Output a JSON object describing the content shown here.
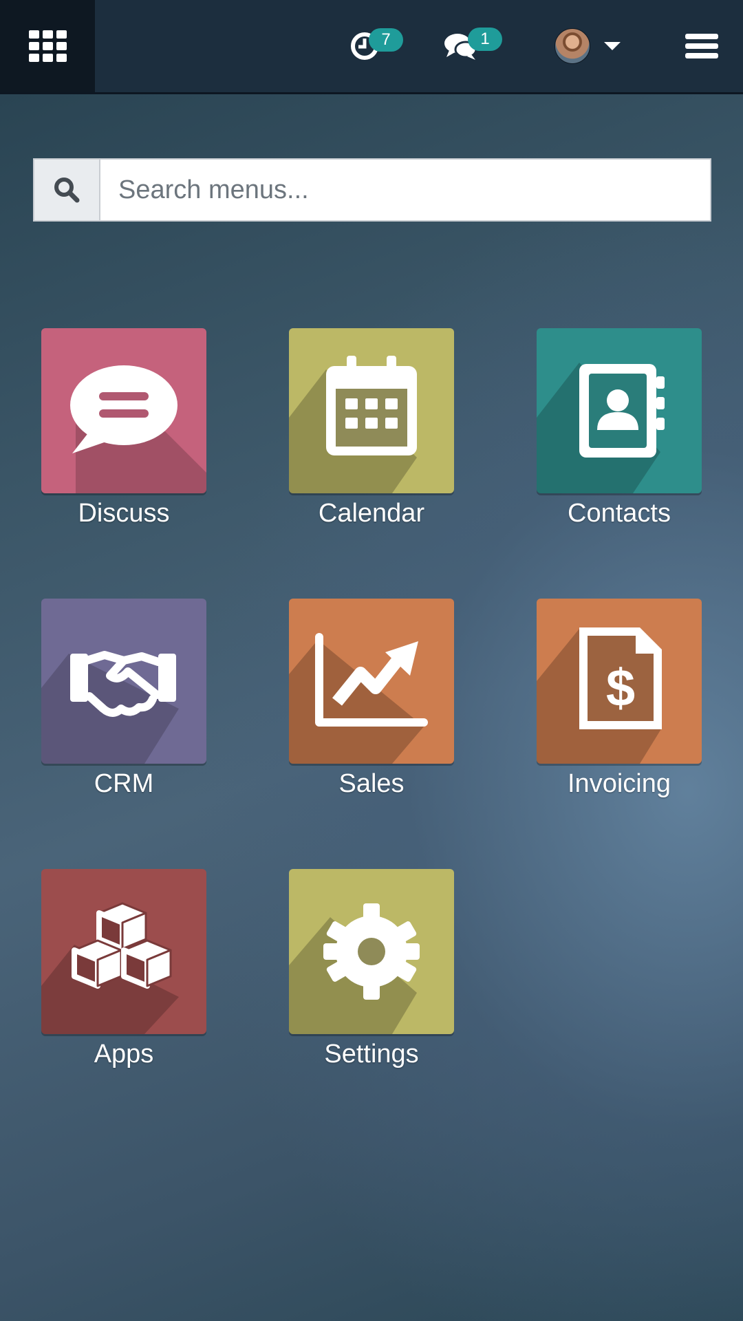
{
  "topbar": {
    "activity_count": "7",
    "messages_count": "1"
  },
  "search": {
    "placeholder": "Search menus..."
  },
  "apps": {
    "discuss": {
      "label": "Discuss",
      "color": "#c5627c"
    },
    "calendar": {
      "label": "Calendar",
      "color": "#bcb866"
    },
    "contacts": {
      "label": "Contacts",
      "color": "#2e8e8b"
    },
    "crm": {
      "label": "CRM",
      "color": "#6f6a94"
    },
    "sales": {
      "label": "Sales",
      "color": "#cd7d4f"
    },
    "invoicing": {
      "label": "Invoicing",
      "color": "#cd7d4f"
    },
    "apps": {
      "label": "Apps",
      "color": "#9c4d4d"
    },
    "settings": {
      "label": "Settings",
      "color": "#bcb866"
    }
  }
}
